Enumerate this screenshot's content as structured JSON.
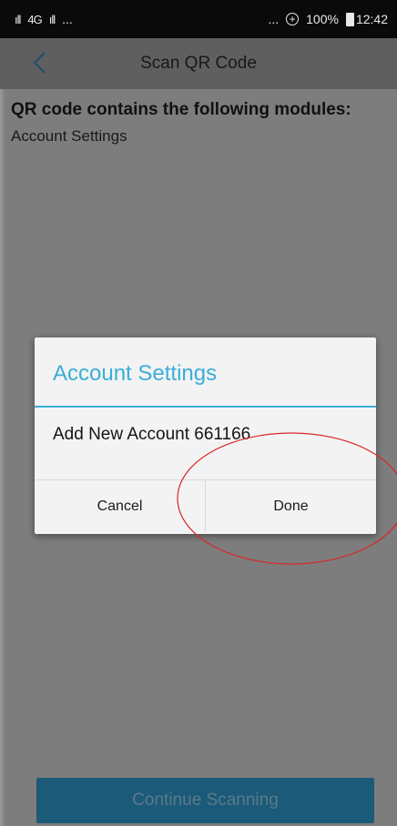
{
  "status_bar": {
    "signal_1": "ıll",
    "network_label": "4G",
    "signal_2": "ıll",
    "left_more": "...",
    "right_more": "...",
    "battery_percent": "100%",
    "time": "12:42"
  },
  "header": {
    "title": "Scan QR Code"
  },
  "content": {
    "heading": "QR code contains the following modules:",
    "modules": [
      "Account Settings"
    ]
  },
  "dialog": {
    "title": "Account Settings",
    "message": "Add New Account 661166",
    "cancel_label": "Cancel",
    "done_label": "Done"
  },
  "footer": {
    "continue_label": "Continue Scanning"
  },
  "colors": {
    "accent": "#3aaed8",
    "annotation": "#d9262a",
    "primary_button": "#1b5a78"
  }
}
